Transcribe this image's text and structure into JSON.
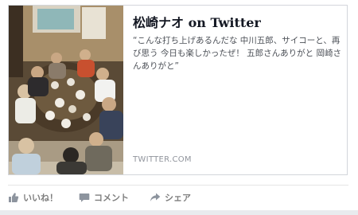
{
  "card": {
    "title": "松崎ナオ on Twitter",
    "description": "“こんな打ち上げあるんだな 中川五郎、サイコーと、再び思う 今日も楽しかったぜ！ 五郎さんありがと 岡崎さんありがと”",
    "domain": "TWITTER.COM",
    "thumbnail_icon": "party-photo"
  },
  "actions": {
    "like_label": "いいね！",
    "comment_label": "コメント",
    "share_label": "シェア"
  },
  "colors": {
    "title": "#141823",
    "text": "#4b4f56",
    "muted": "#90949c",
    "action": "#7f7f7f",
    "border": "#d3d6db"
  }
}
